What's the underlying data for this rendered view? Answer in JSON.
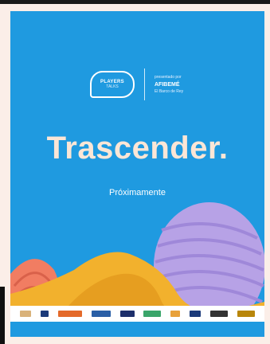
{
  "poster": {
    "logo_line1": "PLAYERS",
    "logo_line2": "TALKS",
    "presented_by": "presentado por",
    "partner": "AFIBEMÉ",
    "partner_sub": "El Barco de Rey",
    "title": "Trascender.",
    "subtitle": "Próximamente"
  },
  "sponsors": [
    "sponsor-1",
    "sponsor-2",
    "sponsor-3",
    "sponsor-4",
    "sponsor-5",
    "sponsor-6",
    "sponsor-7",
    "sponsor-8",
    "sponsor-9",
    "sponsor-10",
    "sponsor-11"
  ],
  "colors": {
    "background": "#1f9ae0",
    "title": "#fbe6d6",
    "ribbon": "#f2b12d",
    "purple": "#b7a2e6",
    "coral": "#f17d62"
  }
}
